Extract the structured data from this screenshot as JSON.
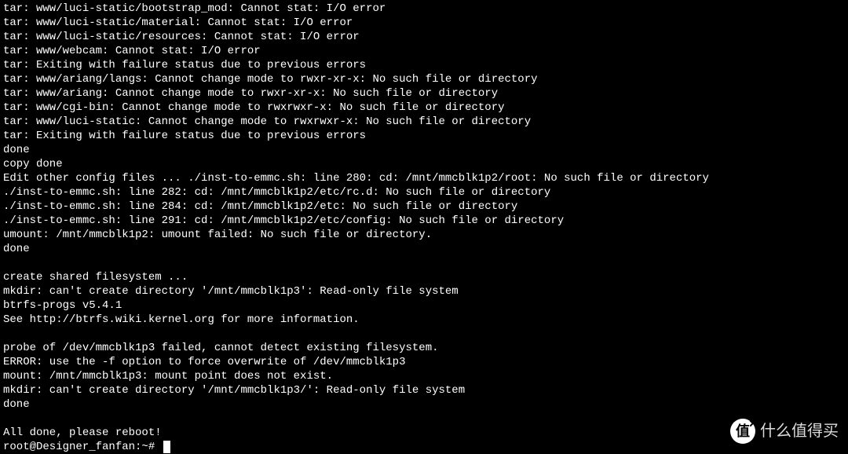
{
  "terminal": {
    "lines": [
      "tar: www/luci-static/bootstrap_mod: Cannot stat: I/O error",
      "tar: www/luci-static/material: Cannot stat: I/O error",
      "tar: www/luci-static/resources: Cannot stat: I/O error",
      "tar: www/webcam: Cannot stat: I/O error",
      "tar: Exiting with failure status due to previous errors",
      "tar: www/ariang/langs: Cannot change mode to rwxr-xr-x: No such file or directory",
      "tar: www/ariang: Cannot change mode to rwxr-xr-x: No such file or directory",
      "tar: www/cgi-bin: Cannot change mode to rwxrwxr-x: No such file or directory",
      "tar: www/luci-static: Cannot change mode to rwxrwxr-x: No such file or directory",
      "tar: Exiting with failure status due to previous errors",
      "done",
      "copy done",
      "Edit other config files ... ./inst-to-emmc.sh: line 280: cd: /mnt/mmcblk1p2/root: No such file or directory",
      "./inst-to-emmc.sh: line 282: cd: /mnt/mmcblk1p2/etc/rc.d: No such file or directory",
      "./inst-to-emmc.sh: line 284: cd: /mnt/mmcblk1p2/etc: No such file or directory",
      "./inst-to-emmc.sh: line 291: cd: /mnt/mmcblk1p2/etc/config: No such file or directory",
      "umount: /mnt/mmcblk1p2: umount failed: No such file or directory.",
      "done",
      "",
      "create shared filesystem ...",
      "mkdir: can't create directory '/mnt/mmcblk1p3': Read-only file system",
      "btrfs-progs v5.4.1",
      "See http://btrfs.wiki.kernel.org for more information.",
      "",
      "probe of /dev/mmcblk1p3 failed, cannot detect existing filesystem.",
      "ERROR: use the -f option to force overwrite of /dev/mmcblk1p3",
      "mount: /mnt/mmcblk1p3: mount point does not exist.",
      "mkdir: can't create directory '/mnt/mmcblk1p3/': Read-only file system",
      "done",
      "",
      "All done, please reboot!"
    ],
    "prompt": "root@Designer_fanfan:~# "
  },
  "watermark": {
    "icon_text": "值",
    "text": "什么值得买"
  }
}
